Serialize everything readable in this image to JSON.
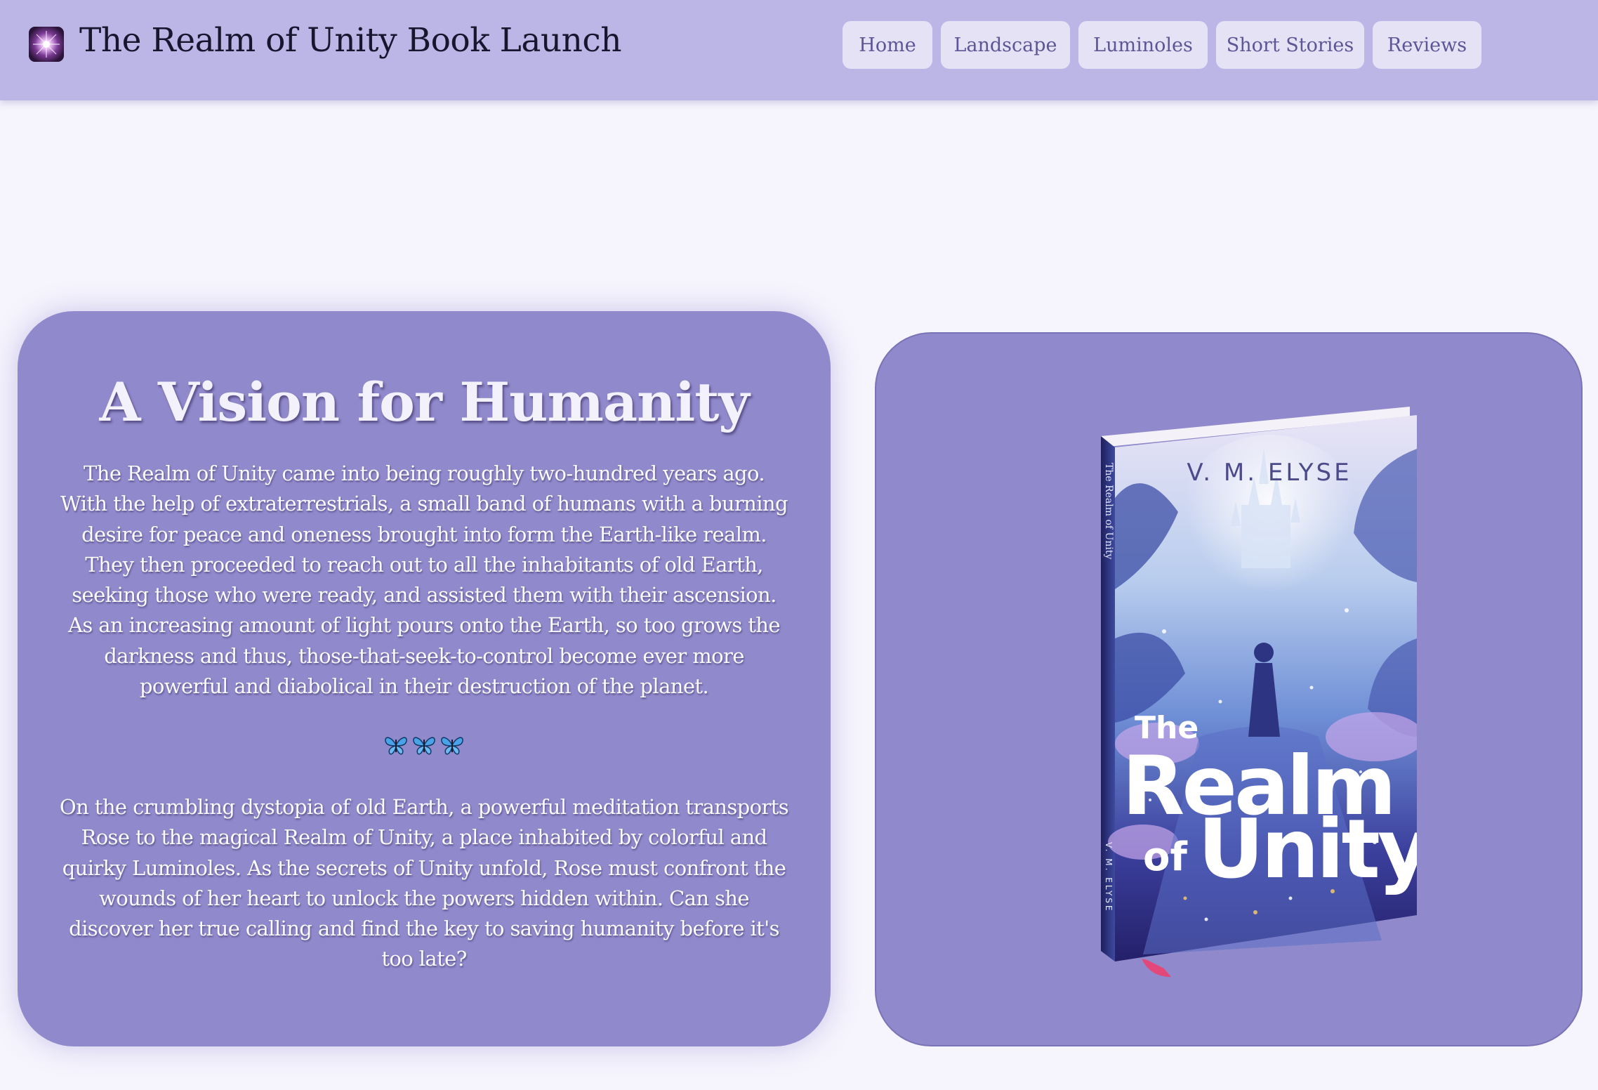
{
  "header": {
    "title": "The Realm of Unity Book Launch",
    "logo_icon": "sparkle-logo-icon",
    "nav": [
      {
        "label": "Home"
      },
      {
        "label": "Landscape"
      },
      {
        "label": "Luminoles"
      },
      {
        "label": "Short Stories"
      },
      {
        "label": "Reviews"
      }
    ]
  },
  "intro": {
    "heading": "A Vision for Humanity",
    "paragraph1": "The Realm of Unity came into being roughly two-hundred years ago. With the help of extraterrestrials, a small band of humans with a burning desire for peace and oneness brought into form the Earth-like realm. They then proceeded to reach out to all the inhabitants of old Earth, seeking those who were ready, and assisted them with their ascension. As an increasing amount of light pours onto the Earth, so too grows the darkness and thus, those-that-seek-to-control become ever more powerful and diabolical in their destruction of the planet.",
    "divider_icons": [
      "butterfly-icon",
      "butterfly-icon",
      "butterfly-icon"
    ],
    "paragraph2": "On the crumbling dystopia of old Earth, a powerful meditation transports Rose to the magical Realm of Unity, a place inhabited by colorful and quirky Luminoles. As the secrets of Unity unfold, Rose must confront the wounds of her heart to unlock the powers hidden within. Can she discover her true calling and find the key to saving humanity before it's too late?"
  },
  "book": {
    "author": "V. M. ELYSE",
    "title_the": "The",
    "title_realm": "Realm",
    "title_of": "of",
    "title_unity": "Unity",
    "spine_title": "The Realm of Unity",
    "spine_author": "V. M. ELYSE"
  },
  "colors": {
    "header_bg": "#bbb6e6",
    "page_bg": "#f6f4fd",
    "card_bg": "#9089cb",
    "nav_button_bg": "#e4e2f4",
    "nav_text": "#5d5696"
  }
}
